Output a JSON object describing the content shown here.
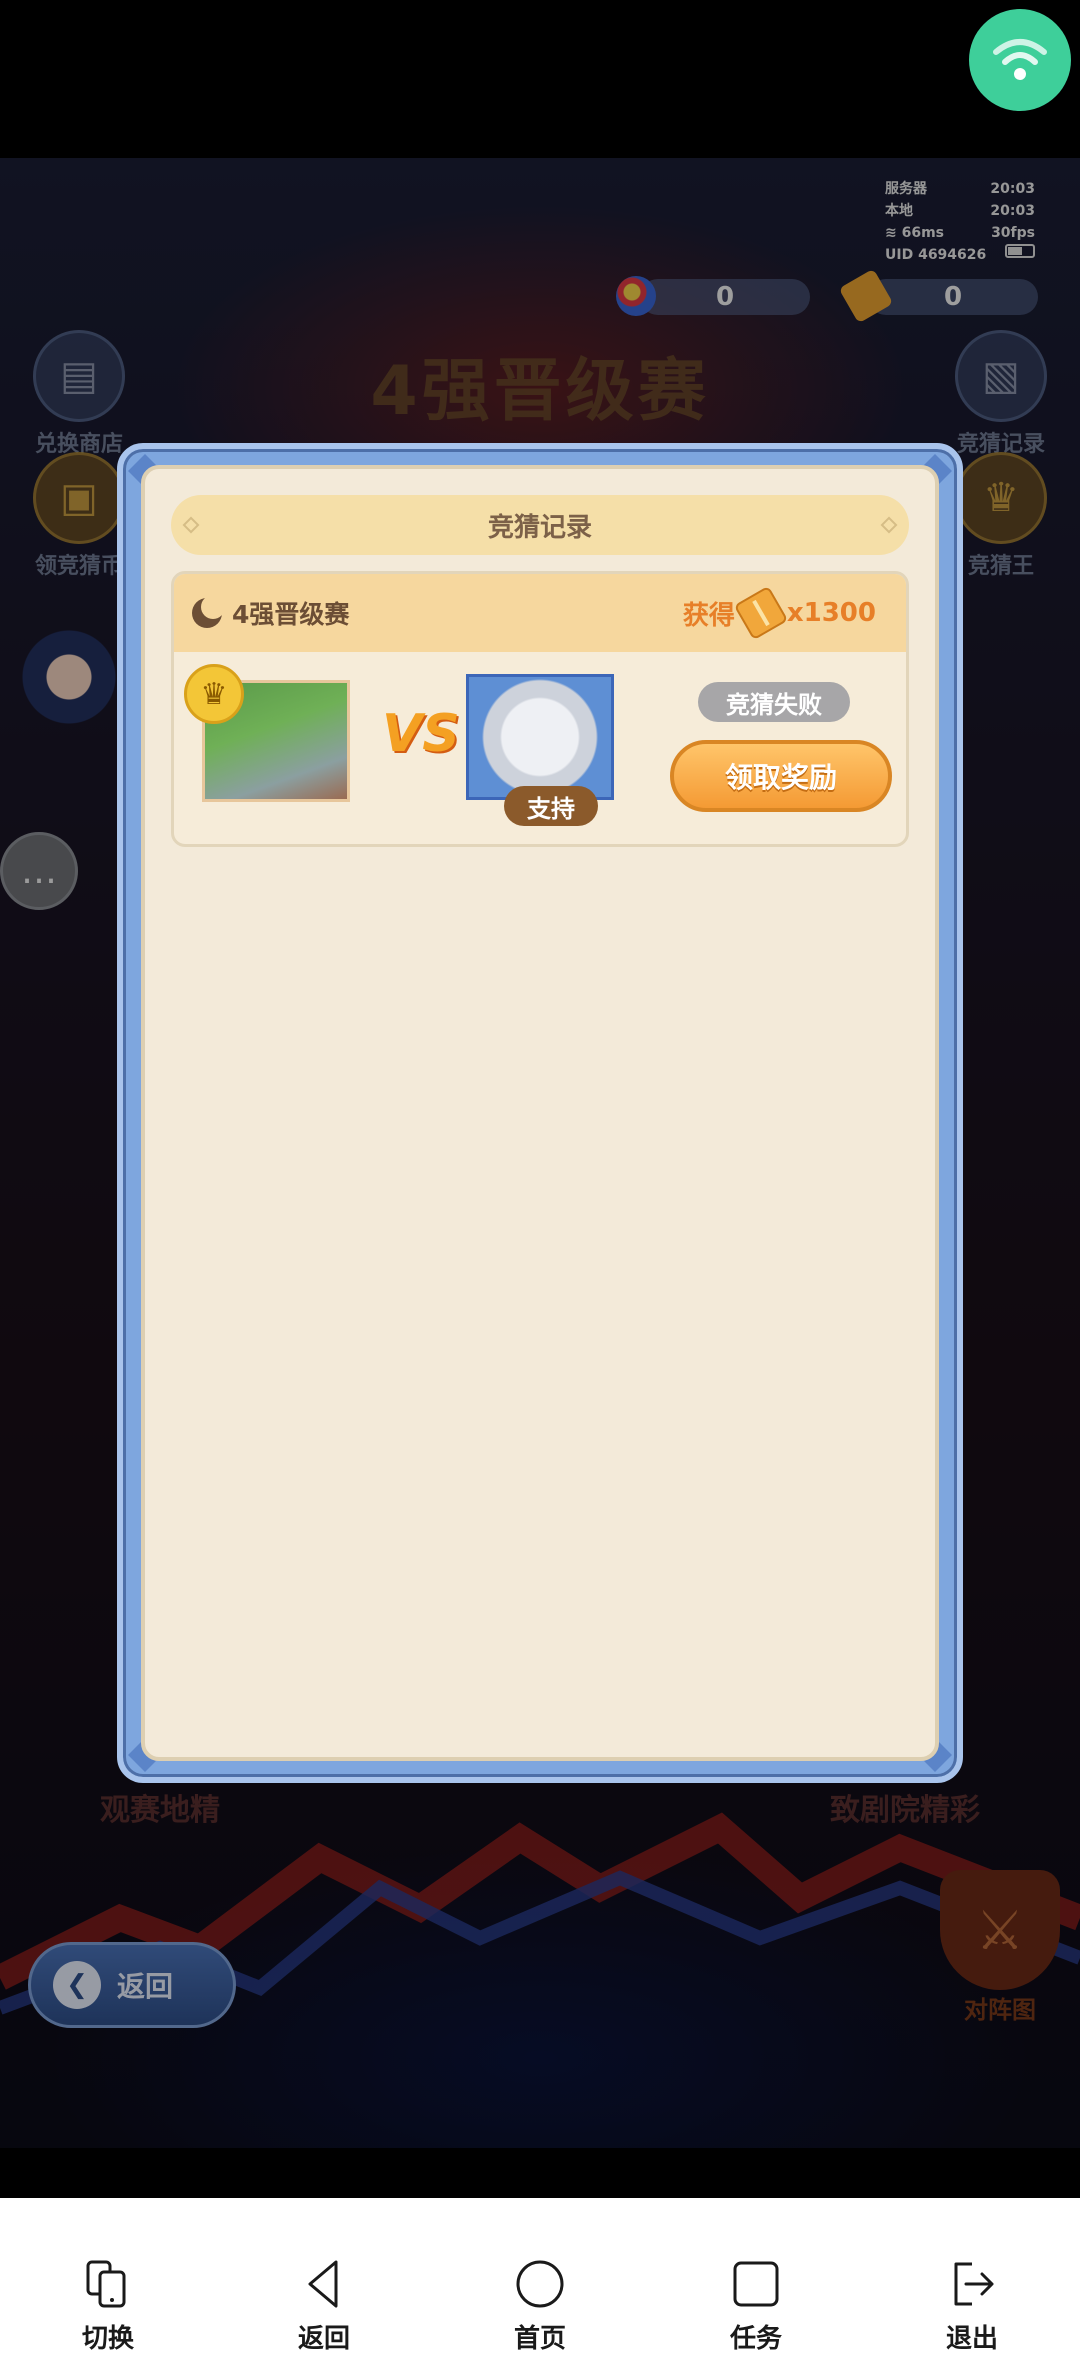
{
  "status_overlay": {
    "server_label": "服务器",
    "server_time": "20:03",
    "local_label": "本地",
    "local_time": "20:03",
    "ping": "66ms",
    "fps": "30fps",
    "uid": "UID 4694626",
    "battery_level": "51"
  },
  "currencies": [
    {
      "icon": "gem-icon",
      "value": "0"
    },
    {
      "icon": "ticket-icon",
      "value": "0"
    }
  ],
  "background": {
    "event_title": "4强晋级赛",
    "left_buttons": [
      {
        "label": "兑换商店",
        "icon": "shop-icon"
      },
      {
        "label": "领竞猜币",
        "icon": "coin-chest-icon"
      }
    ],
    "right_buttons": [
      {
        "label": "竞猜记录",
        "icon": "record-icon"
      },
      {
        "label": "竞猜王",
        "icon": "king-icon"
      }
    ],
    "bottom_tabs": [
      "观赛地精",
      "致剧院精彩"
    ],
    "back_button": "返回",
    "battle_map_label": "对阵图"
  },
  "modal": {
    "title": "竞猜记录",
    "record": {
      "match_name": "4强晋级赛",
      "reward_prefix": "获得",
      "reward_amount": "x1300",
      "vs_label": "VS",
      "support_label": "支持",
      "result_label": "竞猜失败",
      "claim_button": "领取奖励"
    }
  },
  "nav_bar": [
    {
      "label": "切换",
      "icon": "switch-device-icon"
    },
    {
      "label": "返回",
      "icon": "back-triangle-icon"
    },
    {
      "label": "首页",
      "icon": "home-circle-icon"
    },
    {
      "label": "任务",
      "icon": "task-square-icon"
    },
    {
      "label": "退出",
      "icon": "exit-icon"
    }
  ],
  "colors": {
    "modal_frame": "#7ea6de",
    "modal_body": "#f3ead9",
    "accent_orange": "#f49a34",
    "wifi_bubble": "#3ecf9a"
  }
}
